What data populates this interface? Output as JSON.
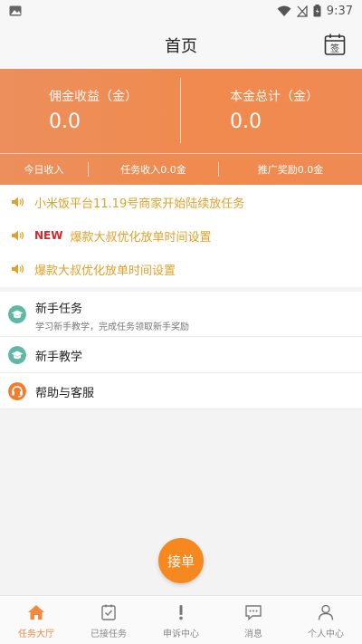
{
  "status_bar": {
    "time": "9:37",
    "icons": [
      "image-icon",
      "wifi-icon",
      "signal-icon",
      "battery-icon"
    ]
  },
  "header": {
    "title": "首页",
    "sign_icon_text": "签"
  },
  "banner": {
    "commission_label": "佣金收益（金）",
    "commission_value": "0.0",
    "principal_label": "本金总计（金）",
    "principal_value": "0.0",
    "today_income": "今日收入",
    "task_income": "任务收入0.0金",
    "promo_reward": "推广奖励0.0金"
  },
  "notices": [
    {
      "text": "小米饭平台11.19号商家开始陆续放任务",
      "badge": ""
    },
    {
      "text": "爆款大叔优化放单时间设置",
      "badge": "NEW"
    },
    {
      "text": "爆款大叔优化放单时间设置",
      "badge": ""
    }
  ],
  "menu": [
    {
      "title": "新手任务",
      "subtitle": "学习新手教学，完成任务领取新手奖励",
      "icon": "graduation-cap-icon"
    },
    {
      "title": "新手教学",
      "subtitle": "",
      "icon": "graduation-cap-icon"
    },
    {
      "title": "帮助与客服",
      "subtitle": "",
      "icon": "headset-icon"
    }
  ],
  "fab_label": "接单",
  "tabs": [
    {
      "label": "任务大厅",
      "icon": "home-icon",
      "active": true
    },
    {
      "label": "已接任务",
      "icon": "clipboard-check-icon",
      "active": false
    },
    {
      "label": "申诉中心",
      "icon": "exclamation-icon",
      "active": false
    },
    {
      "label": "消息",
      "icon": "chat-bubble-icon",
      "active": false
    },
    {
      "label": "个人中心",
      "icon": "user-icon",
      "active": false
    }
  ],
  "colors": {
    "accent": "#f08a3e",
    "notice_text": "#e0a12a",
    "new_badge": "#d8262b",
    "fab": "#f5891f",
    "teal_icon": "#5fb8a6",
    "orange_icon": "#f57c2a"
  }
}
